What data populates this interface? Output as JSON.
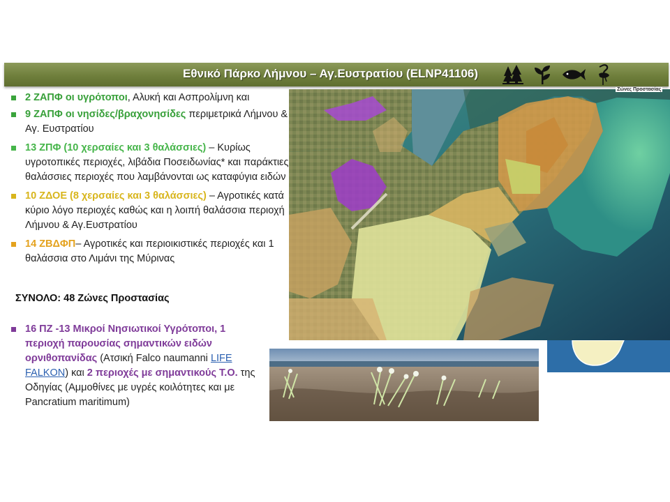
{
  "header": {
    "title": "Εθνικό Πάρκο Λήμνου – Αγ.Ευστρατίου (ELNP41106)",
    "icons": [
      "trees-icon",
      "plant-icon",
      "fish-icon",
      "flamingo-icon"
    ]
  },
  "colors": {
    "banner": "#6f7f3c",
    "green": "#38a03a",
    "yellow": "#d8b51c",
    "orange": "#e4a21e",
    "purple": "#7f3b99",
    "link": "#2a5fb0"
  },
  "bullets": [
    {
      "highlight": "2 ΖΑΠΦ οι υγρότοποι",
      "text": ", Αλυκή και Ασπρολίμνη  και"
    },
    {
      "highlight": "9 ΖΑΠΦ οι νησίδες/βραχονησίδες",
      "text": " περιμετρικά Λήμνου & Αγ. Ευστρατίου"
    },
    {
      "highlight": "13 ΖΠΦ (10 χερσαίες και 3 θαλάσσιες)",
      "text": " – Κυρίως υγροτοπικές περιοχές, λιβάδια Ποσειδωνίας* και παράκτιες θαλάσσιες περιοχές που λαμβάνονται ως καταφύγια ειδών"
    },
    {
      "highlight": "10 ΖΔΟΕ (8 χερσαίες και 3 θαλάσσιες)",
      "text": " – Αγροτικές κατά κύριο λόγο περιοχές καθώς και η λοιπή θαλάσσια περιοχή Λήμνου & Αγ.Ευστρατίου"
    },
    {
      "highlight": "14 ΖΒΔΦΠ",
      "text": "– Αγροτικές και περιοικιστικές περιοχές και 1 θαλάσσια στο Λιμάνι της Μύρινας"
    }
  ],
  "total": "ΣΥΝΟΛΟ: 48 Ζώνες Προστασίας",
  "bottom_bullet": {
    "highlight1": "16 ΠΖ -13 Μικροί Νησιωτικοί Υγρότοποι, 1 περιοχή παρουσίας σημαντικών ειδών ορνιθοπανίδας",
    "text1": " (Ατσική Falco naumanni ",
    "link": "LIFE FALKON",
    "text2": ") και ",
    "highlight2": "2 περιοχές με σημαντικούς Τ.Ο.",
    "text3": " της Οδηγίας (Αμμοθίνες με υγρές κοιλότητες και με Pancratium maritimum)"
  },
  "map": {
    "legend_title": "Ζώνες Προστασίας"
  }
}
